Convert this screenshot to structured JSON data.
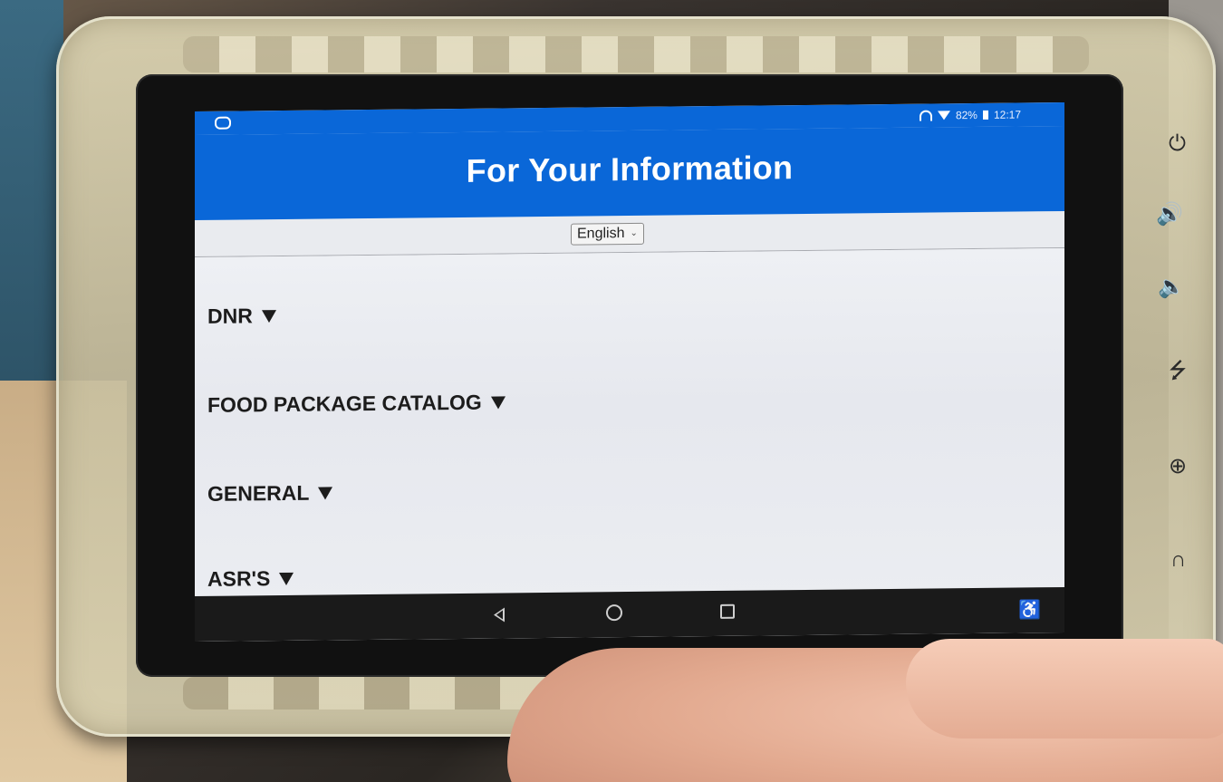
{
  "status_bar": {
    "battery": "82%",
    "time": "12:17",
    "icons": [
      "sync-icon",
      "headphone-icon",
      "wifi-icon",
      "battery-icon"
    ]
  },
  "header": {
    "title": "For Your Information"
  },
  "language": {
    "selected": "English"
  },
  "sections": [
    {
      "label": "DNR"
    },
    {
      "label": "FOOD PACKAGE CATALOG"
    },
    {
      "label": "GENERAL"
    },
    {
      "label": "ASR'S"
    }
  ],
  "nav": {
    "icons": [
      "back-icon",
      "home-icon",
      "recents-icon",
      "accessibility-icon"
    ]
  },
  "colors": {
    "header": "#0a67d8",
    "content_bg": "#eef0f3"
  }
}
